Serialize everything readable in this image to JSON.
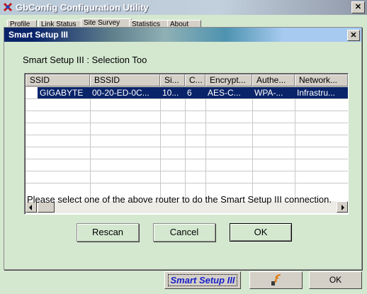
{
  "outer_window": {
    "title": "GbConfig Configuration Utility",
    "close_label": "✕",
    "tabs": [
      "Profile",
      "Link Status",
      "Site Survey",
      "Statistics",
      "About"
    ]
  },
  "dialog": {
    "title": "Smart Setup III",
    "close_label": "✕",
    "subtitle": "Smart Setup III : Selection Too",
    "columns": [
      "SSID",
      "BSSID",
      "Si...",
      "C...",
      "Encrypt...",
      "Authe...",
      "Network..."
    ],
    "rows": [
      [
        "GIGABYTE",
        "00-20-ED-0C...",
        "10...",
        "6",
        "AES-C...",
        "WPA-...",
        "Infrastru..."
      ]
    ],
    "selected_row": 0,
    "instruction": "Please select one of the above router to do the Smart Setup III connection.",
    "buttons": {
      "rescan": "Rescan",
      "cancel": "Cancel",
      "ok": "OK"
    }
  },
  "bottom_bar": {
    "smart_setup_label": "Smart Setup III",
    "wps_icon": "wps-signal-icon",
    "ok_label": "OK"
  },
  "colors": {
    "background": "#d4e8d0",
    "selection": "#0a246a",
    "smart_setup_text": "#1a20c8"
  }
}
